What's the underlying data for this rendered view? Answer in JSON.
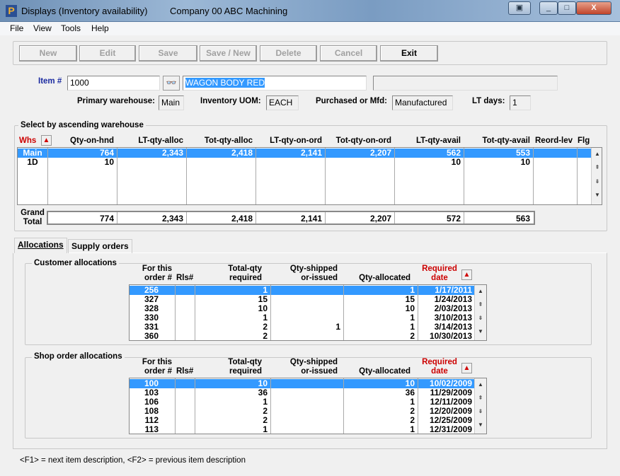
{
  "window": {
    "title": "Displays (Inventory availability)",
    "company": "Company 00  ABC Machining"
  },
  "menu": [
    "File",
    "View",
    "Tools",
    "Help"
  ],
  "toolbar": {
    "new": "New",
    "edit": "Edit",
    "save": "Save",
    "save_new": "Save / New",
    "delete": "Delete",
    "cancel": "Cancel",
    "exit": "Exit"
  },
  "item": {
    "label": "Item #",
    "value": "1000",
    "description": "WAGON BODY RED",
    "description2": "",
    "primary_warehouse_label": "Primary warehouse:",
    "primary_warehouse": "Main",
    "uom_label": "Inventory UOM:",
    "uom": "EACH",
    "pm_label": "Purchased or Mfd:",
    "pm": "Manufactured",
    "lt_label": "LT days:",
    "lt": "1"
  },
  "warehouse": {
    "title": "Select by ascending warehouse",
    "columns": [
      "Whs",
      "Qty-on-hnd",
      "LT-qty-alloc",
      "Tot-qty-alloc",
      "LT-qty-on-ord",
      "Tot-qty-on-ord",
      "LT-qty-avail",
      "Tot-qty-avail",
      "Reord-lev",
      "Flg"
    ],
    "rows": [
      [
        "Main",
        "764",
        "2,343",
        "2,418",
        "2,141",
        "2,207",
        "562",
        "553",
        "",
        ""
      ],
      [
        "1D",
        "10",
        "",
        "",
        "",
        "",
        "10",
        "10",
        "",
        ""
      ]
    ],
    "total_label": "Grand Total",
    "totals": [
      "774",
      "2,343",
      "2,418",
      "2,141",
      "2,207",
      "572",
      "563"
    ]
  },
  "tabs": [
    "Allocations",
    "Supply orders"
  ],
  "alloc_columns": {
    "order": "For this order #",
    "rls": "Rls#",
    "total": "Total-qty required",
    "shipped": "Qty-shipped or-issued",
    "allocated": "Qty-allocated",
    "date": "Required date"
  },
  "customer": {
    "title": "Customer allocations",
    "rows": [
      [
        "256",
        "",
        "1",
        "",
        "1",
        "1/17/2011"
      ],
      [
        "327",
        "",
        "15",
        "",
        "15",
        "1/24/2013"
      ],
      [
        "328",
        "",
        "10",
        "",
        "10",
        "2/03/2013"
      ],
      [
        "330",
        "",
        "1",
        "",
        "1",
        "3/10/2013"
      ],
      [
        "331",
        "",
        "2",
        "1",
        "1",
        "3/14/2013"
      ],
      [
        "360",
        "",
        "2",
        "",
        "2",
        "10/30/2013"
      ]
    ]
  },
  "shop": {
    "title": "Shop order allocations",
    "rows": [
      [
        "100",
        "",
        "10",
        "",
        "10",
        "10/02/2009"
      ],
      [
        "103",
        "",
        "36",
        "",
        "36",
        "11/29/2009"
      ],
      [
        "106",
        "",
        "1",
        "",
        "1",
        "12/11/2009"
      ],
      [
        "108",
        "",
        "2",
        "",
        "2",
        "12/20/2009"
      ],
      [
        "112",
        "",
        "2",
        "",
        "2",
        "12/25/2009"
      ],
      [
        "113",
        "",
        "1",
        "",
        "1",
        "12/31/2009"
      ]
    ]
  },
  "footer": "<F1> = next item description, <F2> = previous item description"
}
